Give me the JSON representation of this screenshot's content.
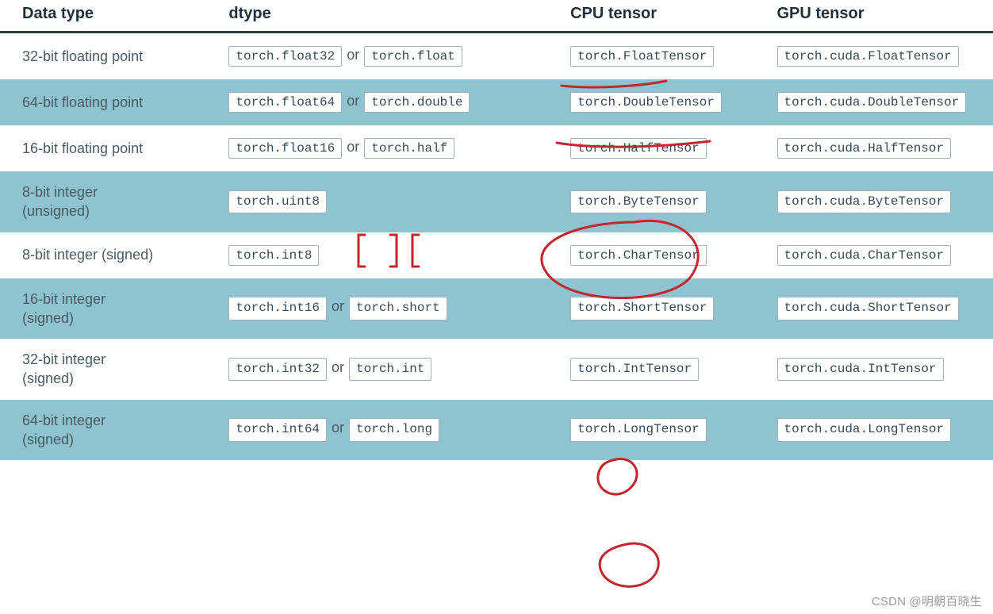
{
  "headers": {
    "data_type": "Data type",
    "dtype": "dtype",
    "cpu": "CPU tensor",
    "gpu": "GPU tensor"
  },
  "or_label": "or",
  "rows": [
    {
      "label": "32-bit floating point",
      "dtype": [
        "torch.float32",
        "torch.float"
      ],
      "cpu": "torch.FloatTensor",
      "gpu": "torch.cuda.FloatTensor",
      "stripe": false,
      "multiline": false
    },
    {
      "label": "64-bit floating point",
      "dtype": [
        "torch.float64",
        "torch.double"
      ],
      "cpu": "torch.DoubleTensor",
      "gpu": "torch.cuda.DoubleTensor",
      "stripe": true,
      "multiline": false
    },
    {
      "label": "16-bit floating point",
      "dtype": [
        "torch.float16",
        "torch.half"
      ],
      "cpu": "torch.HalfTensor",
      "gpu": "torch.cuda.HalfTensor",
      "stripe": false,
      "multiline": false
    },
    {
      "label": "8-bit integer\n(unsigned)",
      "dtype": [
        "torch.uint8"
      ],
      "cpu": "torch.ByteTensor",
      "gpu": "torch.cuda.ByteTensor",
      "stripe": true,
      "multiline": true
    },
    {
      "label": "8-bit integer (signed)",
      "dtype": [
        "torch.int8"
      ],
      "cpu": "torch.CharTensor",
      "gpu": "torch.cuda.CharTensor",
      "stripe": false,
      "multiline": false
    },
    {
      "label": "16-bit integer\n(signed)",
      "dtype": [
        "torch.int16",
        "torch.short"
      ],
      "cpu": "torch.ShortTensor",
      "gpu": "torch.cuda.ShortTensor",
      "stripe": true,
      "multiline": true
    },
    {
      "label": "32-bit integer\n(signed)",
      "dtype": [
        "torch.int32",
        "torch.int"
      ],
      "cpu": "torch.IntTensor",
      "gpu": "torch.cuda.IntTensor",
      "stripe": false,
      "multiline": true
    },
    {
      "label": "64-bit integer\n(signed)",
      "dtype": [
        "torch.int64",
        "torch.long"
      ],
      "cpu": "torch.LongTensor",
      "gpu": "torch.cuda.LongTensor",
      "stripe": true,
      "multiline": true
    }
  ],
  "watermark": "CSDN @明朝百晓生",
  "annotation_color": "#c1272d"
}
